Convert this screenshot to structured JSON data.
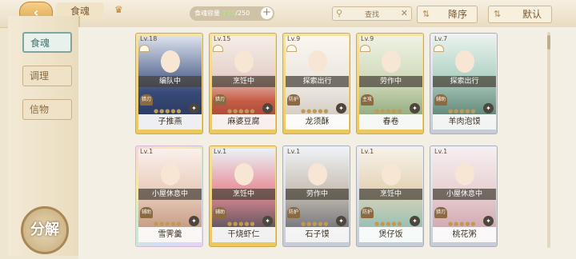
{
  "header": {
    "back_icon": "back-arrow-icon",
    "tab_label": "食魂",
    "capacity_label": "食魂容量",
    "capacity_current": "175",
    "capacity_max": "/250",
    "search_placeholder": "查找",
    "sort_label": "降序",
    "default_label": "默认"
  },
  "sidebar": {
    "items": [
      {
        "label": "食魂",
        "active": true
      },
      {
        "label": "调理",
        "active": false
      },
      {
        "label": "信物",
        "active": false
      }
    ],
    "decompose_label": "分解"
  },
  "cards": [
    {
      "level": "Lv.18",
      "status": "编队中",
      "tag": "猎刃",
      "name": "子推燕",
      "frame": "gold"
    },
    {
      "level": "Lv.15",
      "status": "烹饪中",
      "tag": "猎刃",
      "name": "麻婆豆腐",
      "frame": "gold"
    },
    {
      "level": "Lv.9",
      "status": "探索出行",
      "tag": "防护",
      "name": "龙须酥",
      "frame": "gold"
    },
    {
      "level": "Lv.9",
      "status": "劳作中",
      "tag": "主攻",
      "name": "春卷",
      "frame": "gold"
    },
    {
      "level": "Lv.7",
      "status": "探索出行",
      "tag": "辅助",
      "name": "羊肉泡馍",
      "frame": "silver"
    },
    {
      "level": "Lv.1",
      "status": "小屋休息中",
      "tag": "辅助",
      "name": "雪霁羹",
      "frame": "rainbow"
    },
    {
      "level": "Lv.1",
      "status": "烹饪中",
      "tag": "辅助",
      "name": "干烧虾仁",
      "frame": "gold"
    },
    {
      "level": "Lv.1",
      "status": "劳作中",
      "tag": "防护",
      "name": "石子馍",
      "frame": "silver"
    },
    {
      "level": "Lv.1",
      "status": "烹饪中",
      "tag": "防护",
      "name": "煲仔饭",
      "frame": "silver"
    },
    {
      "level": "Lv.1",
      "status": "小屋休息中",
      "tag": "猎刃",
      "name": "桃花粥",
      "frame": "silver"
    }
  ]
}
